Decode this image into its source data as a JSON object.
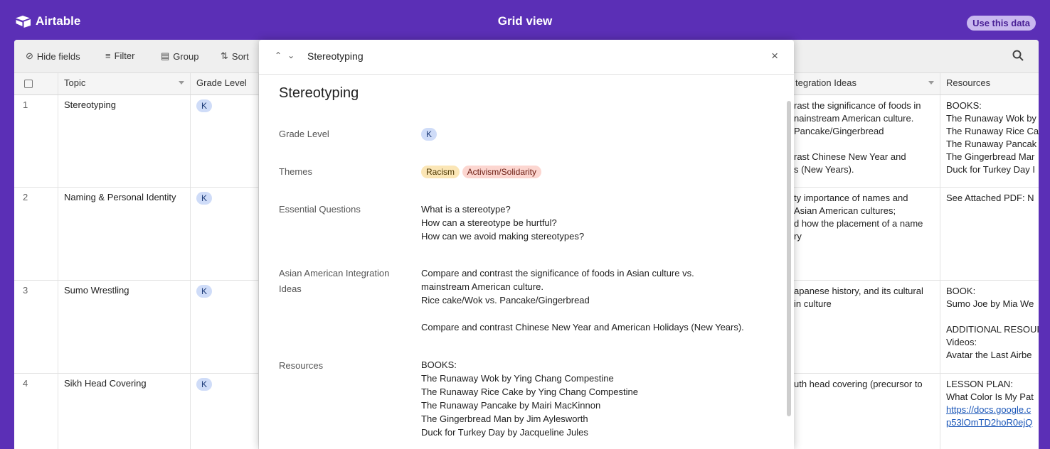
{
  "app": {
    "name": "Airtable",
    "view_title": "Grid view",
    "use_data_label": "Use this data"
  },
  "toolbar": {
    "hide_fields": "Hide fields",
    "filter": "Filter",
    "group": "Group",
    "sort": "Sort"
  },
  "columns": {
    "topic": "Topic",
    "grade_level": "Grade Level",
    "integration": "tegration Ideas",
    "resources": "Resources"
  },
  "rows": [
    {
      "num": "1",
      "topic": "Stereotyping",
      "grade": "K",
      "integration": [
        "rast the significance of foods in",
        "nainstream American culture.",
        "Pancake/Gingerbread",
        "",
        "rast Chinese New Year and",
        "s (New Years)."
      ],
      "resources": [
        "BOOKS:",
        "The Runaway Wok by",
        "The Runaway Rice Ca",
        "The Runaway Pancak",
        "The Gingerbread Mar",
        "Duck for Turkey Day I"
      ]
    },
    {
      "num": "2",
      "topic": "Naming & Personal Identity",
      "grade": "K",
      "integration": [
        "ty importance of names and",
        "Asian American cultures;",
        "d how the placement of a name",
        "ry"
      ],
      "resources": [
        "See Attached PDF: N"
      ]
    },
    {
      "num": "3",
      "topic": "Sumo Wrestling",
      "grade": "K",
      "integration": [
        "apanese history, and its cultural",
        "in culture"
      ],
      "resources": [
        "BOOK:",
        "Sumo Joe by Mia We",
        "",
        "ADDITIONAL RESOUI",
        "Videos:",
        "Avatar the Last Airbe"
      ]
    },
    {
      "num": "4",
      "topic": "Sikh Head Covering",
      "grade": "K",
      "integration": [
        "uth head covering (precursor to"
      ],
      "resources": [
        "LESSON PLAN:",
        "What Color Is My Pat",
        "https://docs.google.c",
        "p53lOmTD2hoR0ejQ"
      ]
    }
  ],
  "modal": {
    "header_title": "Stereotyping",
    "title": "Stereotyping",
    "fields": {
      "grade_label": "Grade Level",
      "grade_value": "K",
      "themes_label": "Themes",
      "themes": [
        "Racism",
        "Activism/Solidarity"
      ],
      "eq_label": "Essential Questions",
      "eq_lines": [
        "What is a stereotype?",
        "How can a stereotype be hurtful?",
        "How can we avoid making stereotypes?"
      ],
      "aai_label_1": "Asian American Integration",
      "aai_label_2": "Ideas",
      "aai_lines": [
        "Compare and contrast the significance of foods in Asian culture vs.",
        "mainstream American culture.",
        "Rice cake/Wok vs. Pancake/Gingerbread",
        "",
        "Compare and contrast Chinese New Year and American Holidays (New Years)."
      ],
      "resources_label": "Resources",
      "resources_lines": [
        "BOOKS:",
        "The Runaway Wok by Ying Chang Compestine",
        "The Runaway Rice Cake by Ying Chang Compestine",
        "The Runaway Pancake by Mairi MacKinnon",
        "The Gingerbread Man by Jim Aylesworth",
        "Duck for Turkey Day by Jacqueline Jules"
      ]
    }
  }
}
